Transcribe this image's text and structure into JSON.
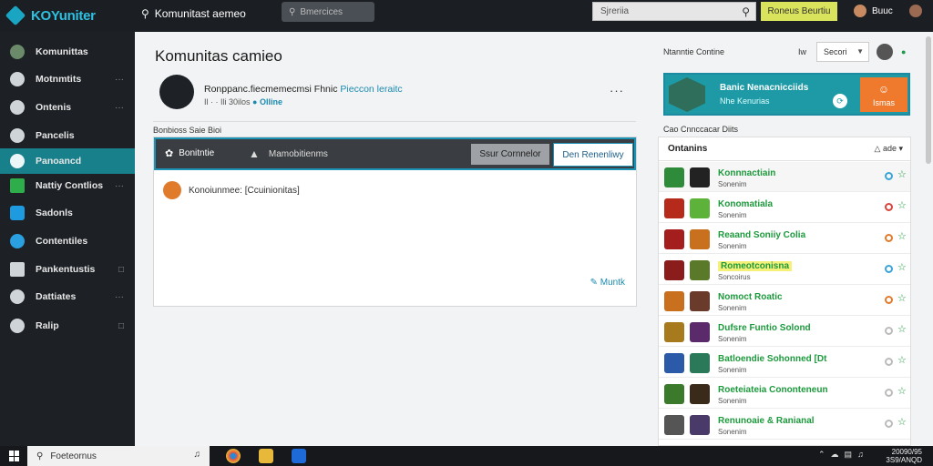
{
  "app": {
    "brand": "KOYuniter",
    "search_primary": "Komunitast aemeo",
    "search_secondary": "Bmercices",
    "search_tertiary_placeholder": "Sjreriia",
    "join_label": "Roneus Beurtiu",
    "user_name": "Buuc"
  },
  "sidebar": {
    "items": [
      {
        "label": "Komunittas",
        "extra": ""
      },
      {
        "label": "Motnmtits",
        "extra": "···"
      },
      {
        "label": "Ontenis",
        "extra": "···"
      },
      {
        "label": "Pancelis",
        "extra": ""
      },
      {
        "label": "Panoancd",
        "extra": ""
      },
      {
        "label": "Nattiy Contlios",
        "extra": "···"
      },
      {
        "label": "Sadonls",
        "extra": ""
      },
      {
        "label": "Contentiles",
        "extra": ""
      },
      {
        "label": "Pankentustis",
        "extra": "□"
      },
      {
        "label": "Dattiates",
        "extra": "···"
      },
      {
        "label": "Ralip",
        "extra": "□"
      }
    ],
    "active_index": 4
  },
  "main": {
    "title": "Komunitas camieo",
    "post": {
      "text": "Ronppanc.fiecmemecmsi Fhnic",
      "highlight": "Pieccon leraitc",
      "meta": "Il · · Ili 30ilos",
      "online": "Olline"
    },
    "subhead": "Bonbioss Saie Bioi",
    "tabs": {
      "tab1": "Bonitntie",
      "tab2": "Mamobitienms",
      "btn_grey": "Ssur Cornnelor",
      "btn_white": "Den Renenliwy"
    },
    "comment": "Konoiunmee: [Ccuinionitas]",
    "link": "Muntk"
  },
  "right": {
    "head": "Ntanntie Contine",
    "sort_label": "Iw",
    "sort_value": "Secori",
    "banner": {
      "title": "Banic Nenacnicciids",
      "subtitle": "Nhe Kenurias",
      "button": "Ismas"
    },
    "sub": "Cao Cnnccacar Diits",
    "list_title": "Ontanins",
    "list_ctl": "ade",
    "rows": [
      {
        "title": "Konnnactiain",
        "sub": "Sonenim",
        "t1": "#2e8b3a",
        "t2": "#222",
        "dot": "#3aa4d8"
      },
      {
        "title": "Konomatiala",
        "sub": "Sonenim",
        "t1": "#b52a1a",
        "t2": "#5db33a",
        "dot": "#d8443a"
      },
      {
        "title": "Reaand Soniiy Colia",
        "sub": "Sonenim",
        "t1": "#a51e1e",
        "t2": "#c8701e",
        "dot": "#e07b2c"
      },
      {
        "title": "Romeotconisna",
        "sub": "Soncoirus",
        "t1": "#8a1c1c",
        "t2": "#5a7a2a",
        "dot": "#3aa4d8",
        "yellow": true
      },
      {
        "title": "Nomoct Roatic",
        "sub": "Sonenim",
        "t1": "#c9701e",
        "t2": "#6a3a2a",
        "dot": "#e07b2c"
      },
      {
        "title": "Dufsre Funtio Solond",
        "sub": "Sonenim",
        "t1": "#a87a1e",
        "t2": "#5a2a6a",
        "dot": "#bbb"
      },
      {
        "title": "Batloendie Sohonned [Dt",
        "sub": "Sonenim",
        "t1": "#2a5aa8",
        "t2": "#2a7a5a",
        "dot": "#bbb"
      },
      {
        "title": "Roeteiateia Cononteneun",
        "sub": "Sonenim",
        "t1": "#3a7a2a",
        "t2": "#3a2a1a",
        "dot": "#bbb"
      },
      {
        "title": "Renunoaie & Ranianal",
        "sub": "Sonenim",
        "t1": "#555",
        "t2": "#4a3a6a",
        "dot": "#bbb"
      },
      {
        "title": "",
        "sub": "",
        "t1": "#222",
        "t2": "#222",
        "dot": "#bbb"
      }
    ]
  },
  "taskbar": {
    "search": "Foeteornus",
    "clock_time": "20090/95",
    "clock_date": "3S9/ANQD"
  }
}
